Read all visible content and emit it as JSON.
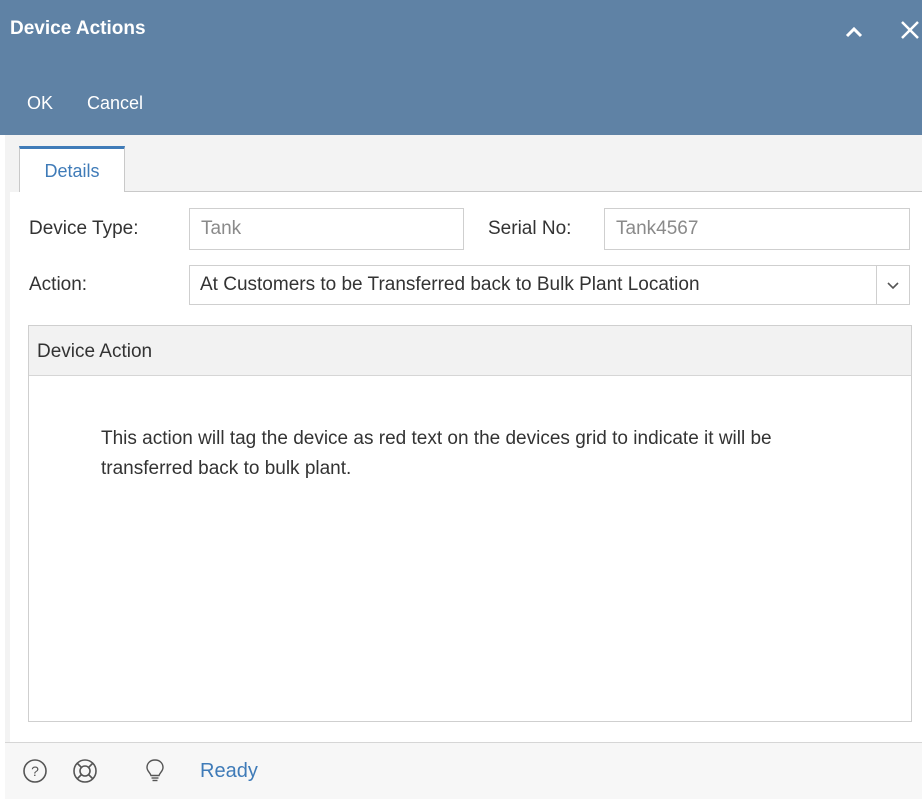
{
  "window": {
    "title": "Device Actions"
  },
  "toolbar": {
    "ok_label": "OK",
    "cancel_label": "Cancel"
  },
  "tabs": [
    {
      "label": "Details",
      "active": true
    }
  ],
  "form": {
    "device_type_label": "Device Type:",
    "device_type_value": "Tank",
    "serial_no_label": "Serial No:",
    "serial_no_value": "Tank4567",
    "action_label": "Action:",
    "action_value": "At Customers to be Transferred back to Bulk Plant Location"
  },
  "panel": {
    "title": "Device Action",
    "description": "This action will tag the device as red text on the devices grid to indicate it will be transferred back to bulk plant."
  },
  "status": {
    "text": "Ready"
  },
  "icons": [
    "chevron-up-icon",
    "close-icon",
    "chevron-down-icon",
    "help-icon",
    "support-icon",
    "lightbulb-icon"
  ],
  "colors": {
    "titlebar": "#5f82a5",
    "accent": "#3f7bb8",
    "body": "#f3f3f3"
  }
}
